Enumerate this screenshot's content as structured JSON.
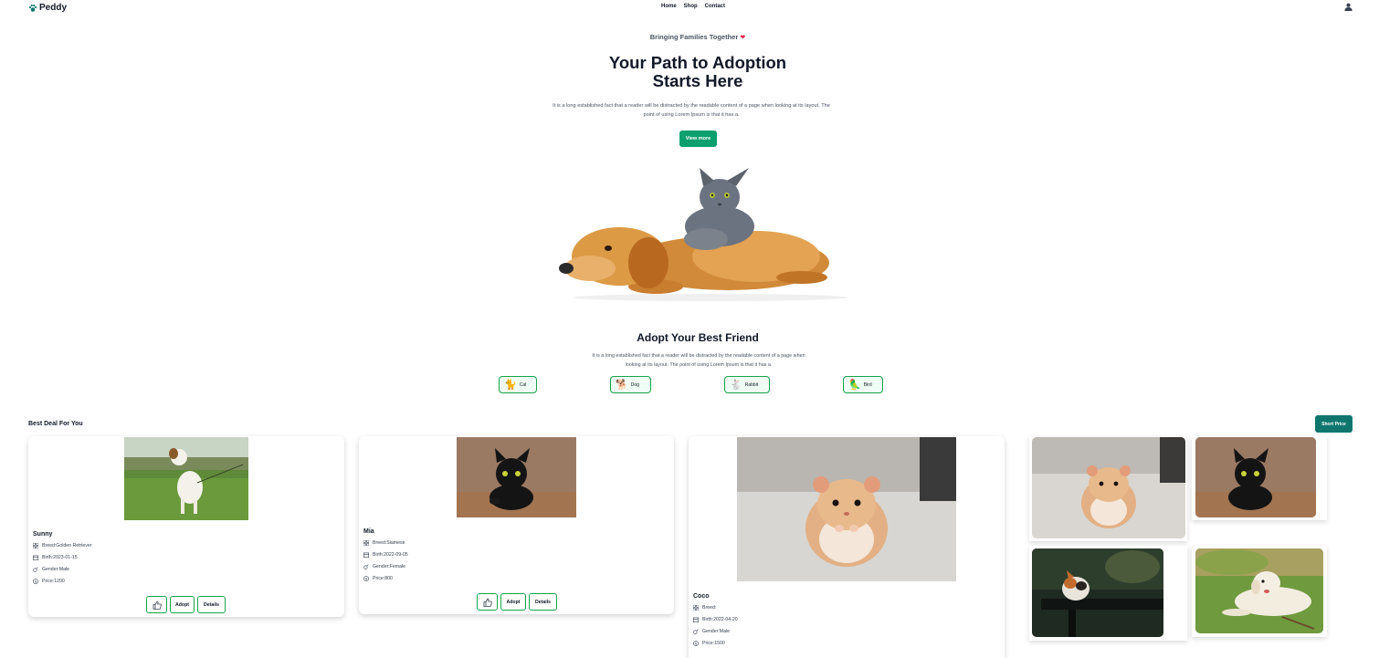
{
  "nav": {
    "brand": "Peddy",
    "links": [
      "Home",
      "Shop",
      "Contact"
    ]
  },
  "hero": {
    "tagline": "Bringing Families Together",
    "title_line1": "Your Path to Adoption",
    "title_line2": "Starts Here",
    "description": "It is a long established fact that a reader will be distracted by the readable content of a page when looking at its layout. The point of using Lorem Ipsum is that it has a.",
    "button": "View more"
  },
  "adopt": {
    "title": "Adopt Your Best Friend",
    "description": "It is a long established fact that a reader will be distracted by the readable content of a page when looking at its layout. The point of using Lorem Ipsum is that it has a.",
    "categories": [
      {
        "label": "Cat",
        "emoji": "🐈"
      },
      {
        "label": "Dog",
        "emoji": "🐕"
      },
      {
        "label": "Rabbit",
        "emoji": "🐇"
      },
      {
        "label": "Bird",
        "emoji": "🦜"
      }
    ]
  },
  "deals": {
    "title": "Best Deal For You",
    "sort_button": "Short Price",
    "pets": [
      {
        "name": "Sunny",
        "breed": "Breed:Golden Retriever",
        "birth": "Birth:2023-01-15",
        "gender": "Gender:Male",
        "price": "Price:1200"
      },
      {
        "name": "Mia",
        "breed": "Breed:Siamese",
        "birth": "Birth:2022-09-05",
        "gender": "Gender:Female",
        "price": "Price:800"
      },
      {
        "name": "Coco",
        "breed": "Breed:",
        "birth": "Birth:2022-04-20",
        "gender": "Gender:Male",
        "price": "Price:1500"
      }
    ],
    "adopt_label": "Adopt",
    "details_label": "Details"
  },
  "colors": {
    "primary_green": "#0d9f6e",
    "sort_teal": "#0f766e",
    "chip_border": "#16a34a"
  }
}
